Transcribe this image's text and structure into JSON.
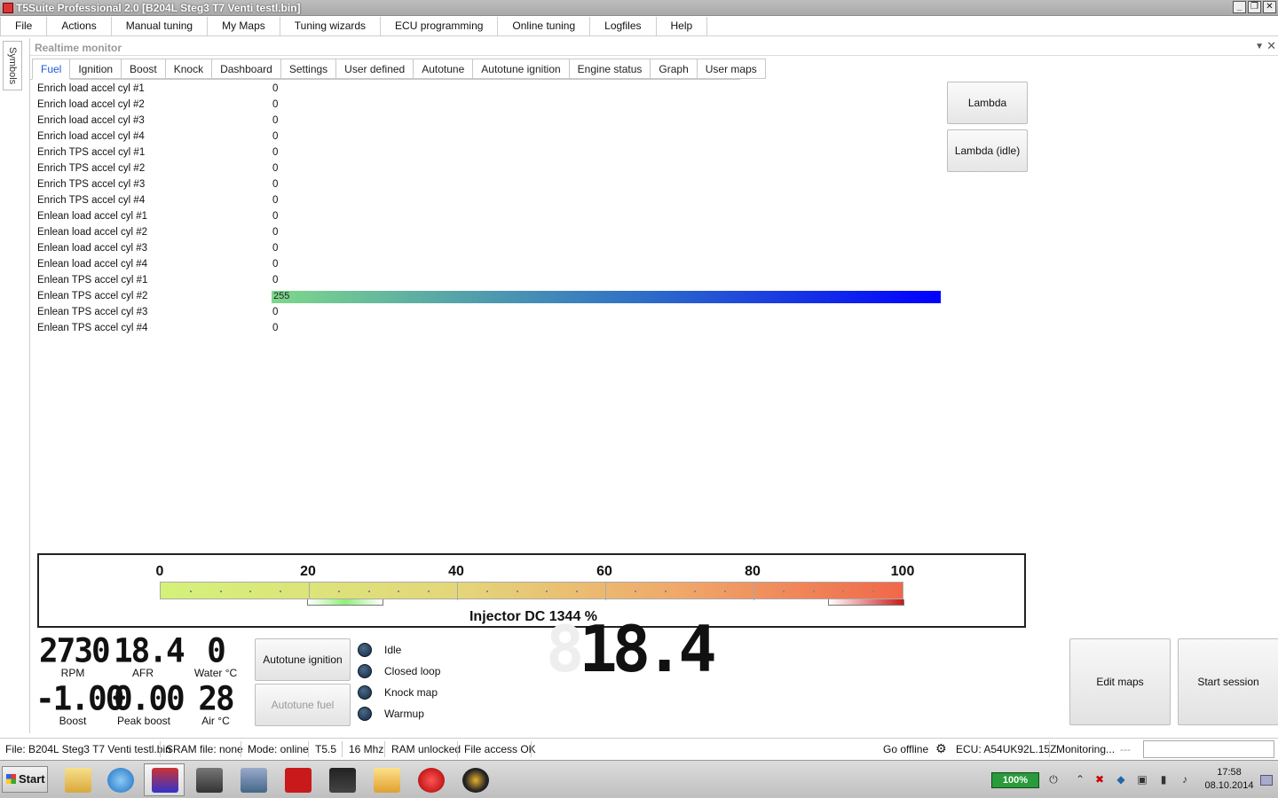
{
  "window": {
    "title": "T5Suite Professional 2.0 [B204L Steg3 T7 Venti testl.bin]",
    "buttons": [
      "_",
      "❐",
      "✕"
    ]
  },
  "menu": [
    "File",
    "Actions",
    "Manual tuning",
    "My Maps",
    "Tuning wizards",
    "ECU programming",
    "Online tuning",
    "Logfiles",
    "Help"
  ],
  "side_tab": "Symbols",
  "panel": {
    "title": "Realtime monitor",
    "pin": "▼",
    "close": "✕"
  },
  "tabs": [
    "Fuel",
    "Ignition",
    "Boost",
    "Knock",
    "Dashboard",
    "Settings",
    "User defined",
    "Autotune",
    "Autotune ignition",
    "Engine status",
    "Graph",
    "User maps"
  ],
  "params": [
    {
      "label": "Enrich load accel cyl #1",
      "value": "0"
    },
    {
      "label": "Enrich load accel cyl #2",
      "value": "0"
    },
    {
      "label": "Enrich load accel cyl #3",
      "value": "0"
    },
    {
      "label": "Enrich load accel cyl #4",
      "value": "0"
    },
    {
      "label": "Enrich TPS accel cyl #1",
      "value": "0"
    },
    {
      "label": "Enrich TPS accel cyl #2",
      "value": "0"
    },
    {
      "label": "Enrich TPS accel cyl #3",
      "value": "0"
    },
    {
      "label": "Enrich TPS accel cyl #4",
      "value": "0"
    },
    {
      "label": "Enlean load accel cyl #1",
      "value": "0"
    },
    {
      "label": "Enlean load accel cyl #2",
      "value": "0"
    },
    {
      "label": "Enlean load accel cyl #3",
      "value": "0"
    },
    {
      "label": "Enlean load accel cyl #4",
      "value": "0"
    },
    {
      "label": "Enlean TPS accel cyl #1",
      "value": "0"
    },
    {
      "label": "Enlean TPS accel cyl #2",
      "value": "255"
    },
    {
      "label": "Enlean TPS accel cyl #3",
      "value": "0"
    },
    {
      "label": "Enlean TPS accel cyl #4",
      "value": "0"
    }
  ],
  "side_buttons": {
    "lambda": "Lambda",
    "lambda_idle": "Lambda (idle)"
  },
  "gauge": {
    "ticks": [
      "0",
      "20",
      "40",
      "60",
      "80",
      "100"
    ],
    "label": "Injector DC 1344 %"
  },
  "dashboard": {
    "rpm": {
      "value": "2730",
      "caption": "RPM"
    },
    "afr": {
      "value": "18.4",
      "caption": "AFR"
    },
    "water": {
      "value": "0",
      "caption": "Water °C"
    },
    "boost": {
      "value": "-1.00",
      "caption": "Boost"
    },
    "peak_boost": {
      "value": "0.00",
      "caption": "Peak boost"
    },
    "air": {
      "value": "28",
      "caption": "Air °C"
    },
    "autotune_ignition": "Autotune ignition",
    "autotune_fuel": "Autotune fuel",
    "indicators": [
      "Idle",
      "Closed loop",
      "Knock map",
      "Warmup"
    ],
    "big_afr": "18.4",
    "edit_maps": "Edit maps",
    "start_session": "Start session"
  },
  "status": {
    "file": "File: B204L Steg3 T7 Venti testl.bin",
    "sram": "SRAM file: none",
    "mode": "Mode: online",
    "ecu_type": "T5.5",
    "clock_speed": "16 Mhz",
    "ram": "RAM unlocked",
    "file_access": "File access OK",
    "go_offline": "Go offline",
    "ecu": "ECU: A54UK92L.15Z",
    "monitoring": "Monitoring...",
    "dashes": "---"
  },
  "taskbar": {
    "start": "Start",
    "battery": "100%",
    "time": "17:58",
    "date": "08.10.2014"
  }
}
